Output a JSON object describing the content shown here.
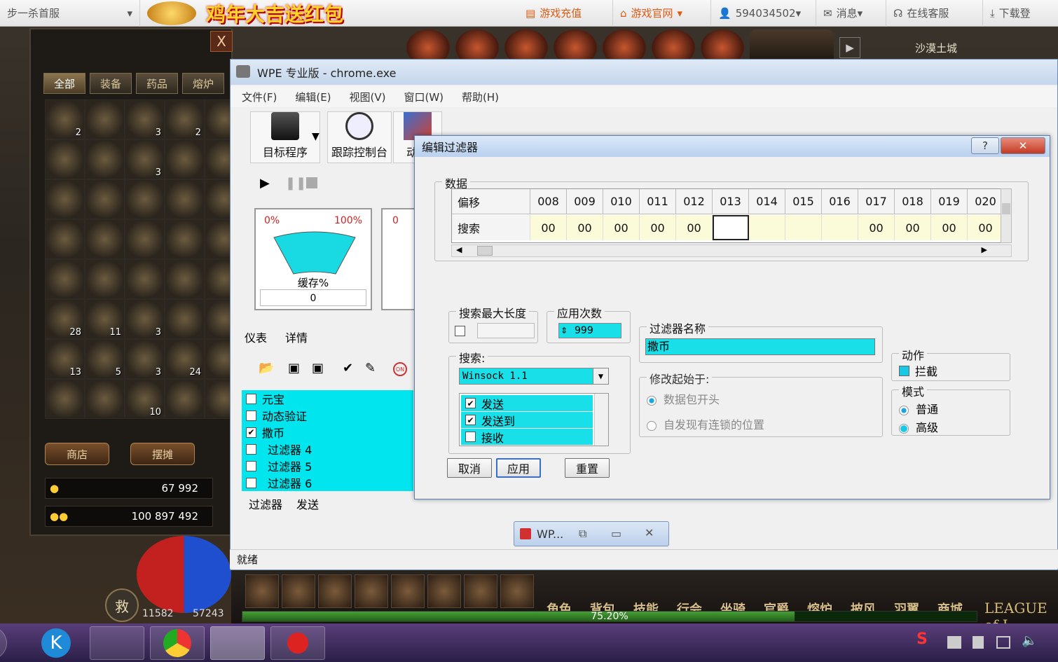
{
  "browser": {
    "tab_text": "步一杀首服",
    "banner": "鸡年大吉送红包",
    "links": [
      "游戏充值",
      "游戏官网",
      "594034502",
      "消息",
      "在线客服",
      "下载登"
    ]
  },
  "inventory": {
    "tabs": [
      "全部",
      "装备",
      "药品",
      "熔炉"
    ],
    "counts": [
      "2",
      "",
      "3",
      "2",
      "",
      "",
      "",
      "3",
      "",
      "",
      "",
      "",
      "",
      "",
      "",
      "",
      "",
      "",
      "",
      "",
      "",
      "",
      "",
      "",
      "",
      "28",
      "11",
      "3",
      "",
      "",
      "13",
      "5",
      "3",
      "24",
      "",
      "",
      "",
      "10",
      "",
      ""
    ],
    "shop_button": "商店",
    "stall_button": "摆摊",
    "gold": "67 992",
    "silver": "100 897 492"
  },
  "game": {
    "top_right": "沙漠土城",
    "menu_items": [
      "角色",
      "背包",
      "技能",
      "行会",
      "坐骑",
      "官爵",
      "熔炉",
      "披风",
      "羽翼",
      "商城"
    ],
    "hp": "11582",
    "mp": "57243",
    "exp_percent": "75.20%",
    "exp_fraction": 0.752,
    "save_label": "救",
    "league": "LEAGUE of L"
  },
  "wpe": {
    "title": "WPE 专业版 - chrome.exe",
    "menu": [
      "文件(F)",
      "编辑(E)",
      "视图(V)",
      "窗口(W)",
      "帮助(H)"
    ],
    "tools": [
      "目标程序",
      "跟踪控制台",
      "动作"
    ],
    "gauge_min": "0%",
    "gauge_max": "100%",
    "gauge_label": "缓存%",
    "gauge_value": "0",
    "gauge2_label": "0",
    "tabs1": [
      "仪表",
      "详情"
    ],
    "filters": [
      {
        "label": "元宝",
        "checked": false
      },
      {
        "label": "动态验证",
        "checked": false
      },
      {
        "label": "撒币",
        "checked": true
      },
      {
        "label": "过滤器 4",
        "checked": false
      },
      {
        "label": "过滤器 5",
        "checked": false
      },
      {
        "label": "过滤器 6",
        "checked": false
      }
    ],
    "tabs2": [
      "过滤器",
      "发送"
    ],
    "status": "就绪",
    "mini_label": "WP..."
  },
  "dialog": {
    "title": "编辑过滤器",
    "help": "?",
    "close": "✕",
    "data_group": "数据",
    "row_offset": "偏移",
    "row_search": "搜索",
    "columns": [
      "008",
      "009",
      "010",
      "011",
      "012",
      "013",
      "014",
      "015",
      "016",
      "017",
      "018",
      "019",
      "020"
    ],
    "values": [
      "00",
      "00",
      "00",
      "00",
      "00",
      "",
      "",
      "",
      "",
      "00",
      "00",
      "00",
      "00"
    ],
    "max_len_label": "搜索最大长度",
    "apply_count_label": "应用次数",
    "apply_count": "999",
    "search_label": "搜索:",
    "protocol": "Winsock 1.1",
    "search_options": [
      {
        "label": "发送",
        "checked": true
      },
      {
        "label": "发送到",
        "checked": true
      },
      {
        "label": "接收",
        "checked": false
      }
    ],
    "name_label": "过滤器名称",
    "name_value": "撒币",
    "modify_label": "修改起始于:",
    "modify_options": [
      "数据包开头",
      "自发现有连锁的位置"
    ],
    "action_label": "动作",
    "action_option": "拦截",
    "mode_label": "模式",
    "mode_options": [
      "普通",
      "高级"
    ],
    "cancel": "取消",
    "apply": "应用",
    "reset": "重置"
  }
}
